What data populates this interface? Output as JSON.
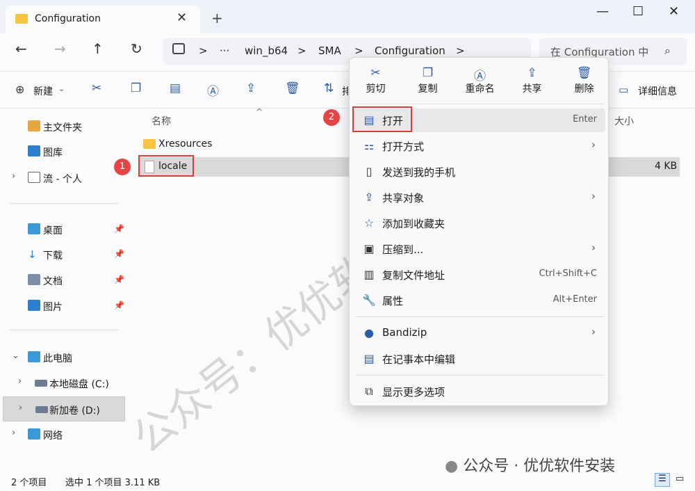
{
  "window": {
    "tab_title": "Configuration",
    "tab_close": "✕",
    "new_tab": "+",
    "minimize": "—",
    "maximize": "☐",
    "close": "✕"
  },
  "nav": {
    "back": "←",
    "forward": "→",
    "up": "↑",
    "refresh": "↻"
  },
  "address": {
    "sep": ">",
    "ellipsis": "···",
    "crumbs": [
      "win_b64",
      "SMA",
      "Configuration"
    ]
  },
  "search": {
    "placeholder": "在 Configuration 中",
    "icon": "search-icon"
  },
  "toolbar": {
    "new_label": "新建",
    "sort_label": "排"
  },
  "sidebar": {
    "home": "主文件夹",
    "gallery": "图库",
    "personal": "流 - 个人",
    "desktop": "桌面",
    "downloads": "下载",
    "documents": "文档",
    "pictures": "图片",
    "thispc": "此电脑",
    "drive_c": "本地磁盘 (C:)",
    "drive_d": "新加卷 (D:)",
    "network": "网络"
  },
  "files": {
    "col_name": "名称",
    "col_size": "大小",
    "rows": [
      {
        "name": "Xresources",
        "size": ""
      },
      {
        "name": "locale",
        "size": "4 KB"
      }
    ]
  },
  "status": {
    "count": "2 个项目",
    "selection": "选中 1 个项目  3.11 KB"
  },
  "context_menu": {
    "quick_actions": [
      "剪切",
      "复制",
      "重命名",
      "共享",
      "删除"
    ],
    "items": [
      {
        "label": "打开",
        "shortcut": "Enter"
      },
      {
        "label": "打开方式",
        "shortcut": ""
      },
      {
        "label": "发送到我的手机",
        "shortcut": ""
      },
      {
        "label": "共享对象",
        "shortcut": ""
      },
      {
        "label": "添加到收藏夹",
        "shortcut": ""
      },
      {
        "label": "压缩到...",
        "shortcut": ""
      },
      {
        "label": "复制文件地址",
        "shortcut": "Ctrl+Shift+C"
      },
      {
        "label": "属性",
        "shortcut": "Alt+Enter"
      },
      {
        "label": "Bandizip",
        "shortcut": ""
      },
      {
        "label": "在记事本中编辑",
        "shortcut": ""
      },
      {
        "label": "显示更多选项",
        "shortcut": ""
      }
    ]
  },
  "annotations": {
    "badge1": "1",
    "badge2": "2"
  },
  "watermark": {
    "diagonal": "公众号：优优软件安装",
    "footer": "公众号 · 优优软件安装"
  }
}
